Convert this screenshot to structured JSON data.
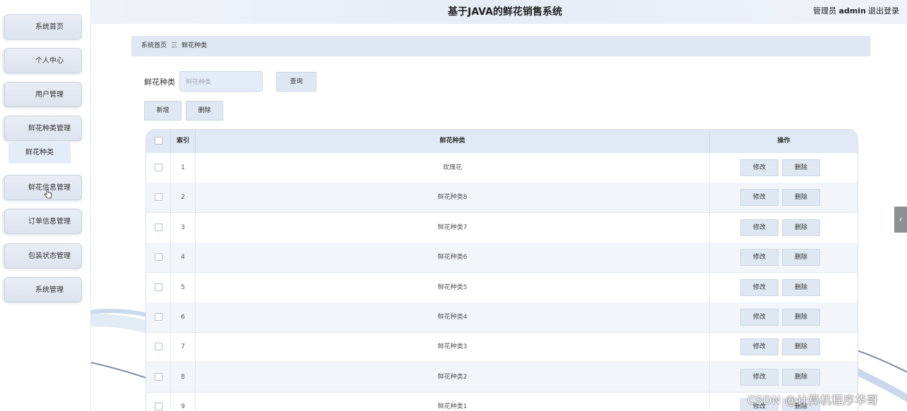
{
  "app_title": "基于JAVA的鲜花销售系统",
  "header": {
    "admin_label": "管理员",
    "admin_name": "admin",
    "logout": "退出登录"
  },
  "sidebar": {
    "items": [
      {
        "label": "系统首页"
      },
      {
        "label": "个人中心"
      },
      {
        "label": "用户管理"
      },
      {
        "label": "鲜花种类管理"
      },
      {
        "label": "鲜花信息管理"
      },
      {
        "label": "订单信息管理"
      },
      {
        "label": "包装状态管理"
      },
      {
        "label": "系统管理"
      }
    ],
    "submenu_label": "鲜花种类"
  },
  "breadcrumb": {
    "home": "系统首页",
    "separator": "三",
    "current": "鲜花种类"
  },
  "search": {
    "label": "鲜花种类",
    "placeholder": "鲜花种类",
    "query_button": "查询"
  },
  "toolbar": {
    "add": "新增",
    "delete": "删除"
  },
  "table": {
    "headers": {
      "index": "索引",
      "category": "鲜花种类",
      "actions": "操作"
    },
    "rows": [
      {
        "index": "1",
        "name": "玫瑰花"
      },
      {
        "index": "2",
        "name": "鲜花种类8"
      },
      {
        "index": "3",
        "name": "鲜花种类7"
      },
      {
        "index": "4",
        "name": "鲜花种类6"
      },
      {
        "index": "5",
        "name": "鲜花种类5"
      },
      {
        "index": "6",
        "name": "鲜花种类4"
      },
      {
        "index": "7",
        "name": "鲜花种类3"
      },
      {
        "index": "8",
        "name": "鲜花种类2"
      },
      {
        "index": "9",
        "name": "鲜花种类1"
      }
    ],
    "edit_label": "修改",
    "delete_label": "删除"
  },
  "watermark": "CSDN @计算机程序华哥",
  "colors": {
    "accent_bg": "#dfe7f3",
    "header_bg": "#eef3f9"
  }
}
